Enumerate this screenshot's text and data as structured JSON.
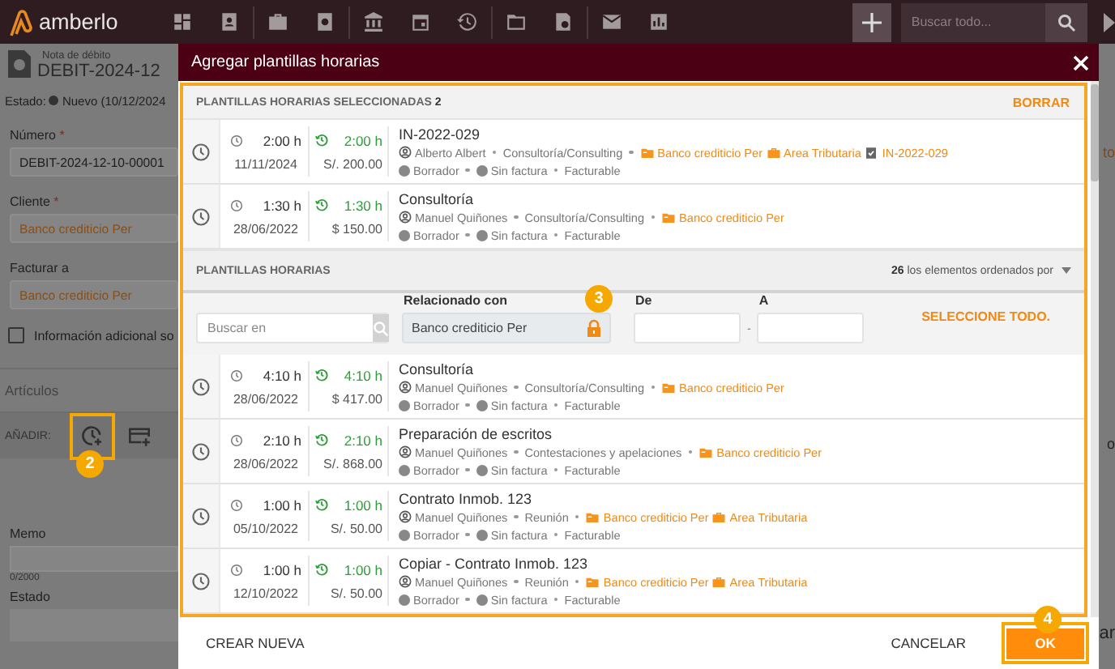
{
  "app": {
    "logo": "amberlo",
    "search_placeholder": "Buscar todo..."
  },
  "form": {
    "doc_type": "Nota de débito",
    "doc_number": "DEBIT-2024-12",
    "status_label": "Estado:",
    "status": "Nuevo (10/12/2024",
    "fields": [
      {
        "label": "Número",
        "required_mark": "*",
        "value": "DEBIT-2024-12-10-00001",
        "kind": "plain"
      },
      {
        "label": "Cliente",
        "required_mark": "*",
        "value": "Banco crediticio Per",
        "kind": "link"
      },
      {
        "label": "Facturar a",
        "value": "Banco crediticio Per",
        "kind": "link"
      }
    ],
    "checkbox": {
      "label": "Información adicional so",
      "checked": false
    },
    "section": "Artículos",
    "add_label": "AÑADIR:",
    "add_badge": "2",
    "memo_label": "Memo",
    "memo_counter": "0/2000",
    "estado_label": "Estado",
    "edge_texts": [
      "to",
      "o",
      "ar"
    ]
  },
  "modal": {
    "title": "Agregar plantillas horarias",
    "selected_header": "PLANTILLAS HORARIAS SELECCIONADAS **2**",
    "clear": "BORRAR",
    "selected": [
      {
        "duration": "2:00 h",
        "date": "11/11/2024",
        "billed": "2:00 h",
        "amount": "S/. 200.00",
        "title": "IN-2022-029",
        "person": "Alberto Albert",
        "category": "Consultoría/Consulting",
        "tags": [
          {
            "kind": "client",
            "text": "Banco crediticio Per"
          },
          {
            "kind": "area",
            "text": "Area Tributaria"
          },
          {
            "kind": "task",
            "text": "IN-2022-029"
          }
        ],
        "status": "Borrador",
        "invoice": "Sin factura",
        "billing": "Facturable"
      },
      {
        "duration": "1:30 h",
        "date": "28/06/2022",
        "billed": "1:30 h",
        "amount": "$ 150.00",
        "title": "Consultoría",
        "person": "Manuel Quiñones",
        "category": "Consultoría/Consulting",
        "tags": [
          {
            "kind": "client",
            "text": "Banco crediticio Per"
          }
        ],
        "status": "Borrador",
        "invoice": "Sin factura",
        "billing": "Facturable"
      }
    ],
    "list_header": "PLANTILLAS HORARIAS",
    "count_text": "**26** los elementos ordenados por",
    "filters": {
      "search_placeholder": "Buscar en",
      "related_label": "Relacionado con",
      "related_value": "Banco crediticio Per",
      "badge": "3",
      "from_label": "De",
      "range_separator": "-",
      "to_label": "A",
      "select_all": "SELECCIONE TODO."
    },
    "entries": [
      {
        "duration": "4:10 h",
        "date": "28/06/2022",
        "billed": "4:10 h",
        "amount": "$ 417.00",
        "title": "Consultoría",
        "person": "Manuel Quiñones",
        "category": "Consultoría/Consulting",
        "tags": [
          {
            "kind": "client",
            "text": "Banco crediticio Per"
          }
        ],
        "status": "Borrador",
        "invoice": "Sin factura",
        "billing": "Facturable"
      },
      {
        "duration": "2:10 h",
        "date": "28/06/2022",
        "billed": "2:10 h",
        "amount": "S/. 868.00",
        "title": "Preparación de escritos",
        "person": "Manuel Quiñones",
        "category": "Contestaciones y apelaciones",
        "tags": [
          {
            "kind": "client",
            "text": "Banco crediticio Per"
          }
        ],
        "status": "Borrador",
        "invoice": "Sin factura",
        "billing": "Facturable"
      },
      {
        "duration": "1:00 h",
        "date": "05/10/2022",
        "billed": "1:00 h",
        "amount": "S/. 50.00",
        "title": "Contrato Inmob. 123",
        "person": "Manuel Quiñones",
        "category": "Reunión",
        "tags": [
          {
            "kind": "client",
            "text": "Banco crediticio Per"
          },
          {
            "kind": "area",
            "text": "Area Tributaria"
          }
        ],
        "status": "Borrador",
        "invoice": "Sin factura",
        "billing": "Facturable"
      },
      {
        "duration": "1:00 h",
        "date": "12/10/2022",
        "billed": "1:00 h",
        "amount": "S/. 50.00",
        "title": "Copiar - Contrato Inmob. 123",
        "person": "Manuel Quiñones",
        "category": "Reunión",
        "tags": [
          {
            "kind": "client",
            "text": "Banco crediticio Per"
          },
          {
            "kind": "area",
            "text": "Area Tributaria"
          }
        ],
        "status": "Borrador",
        "invoice": "Sin factura",
        "billing": "Facturable"
      }
    ],
    "footer": {
      "create": "CREAR NUEVA",
      "cancel": "CANCELAR",
      "ok": "OK",
      "ok_badge": "4"
    }
  }
}
